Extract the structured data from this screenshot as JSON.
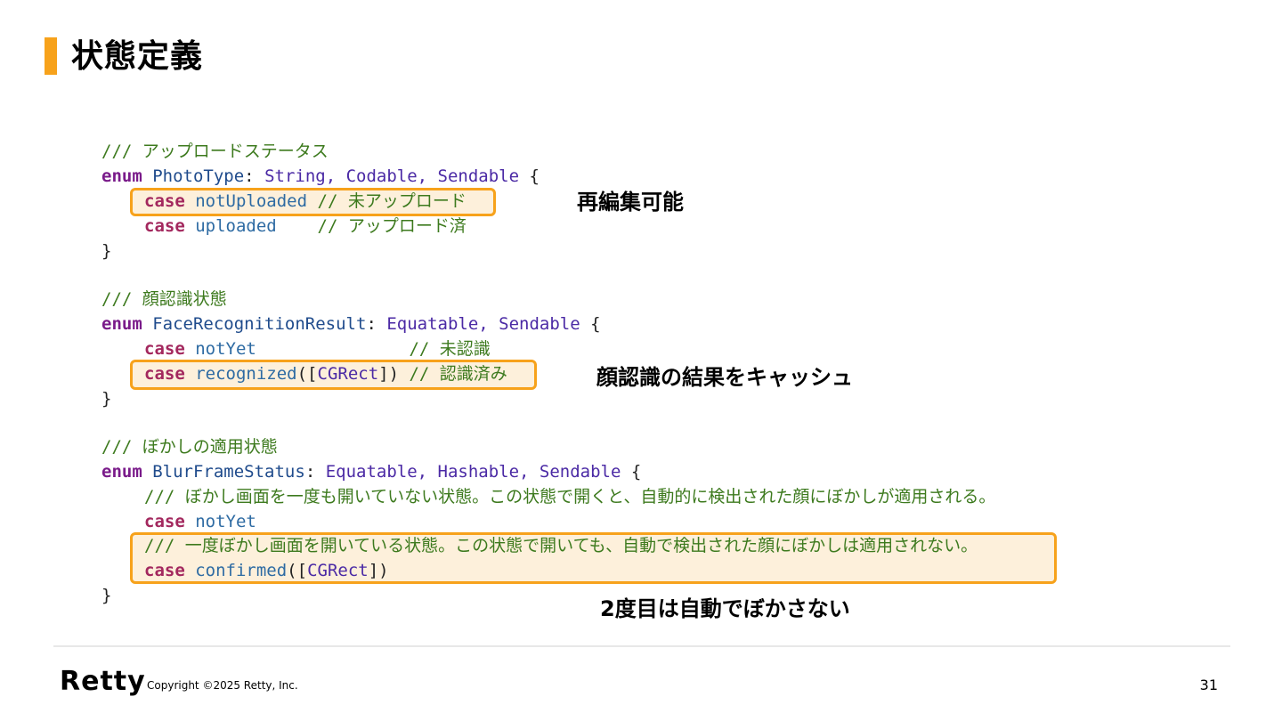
{
  "slide": {
    "title": "状態定義",
    "page_number": "31",
    "brand": "Retty",
    "copyright": "Copyright ©2025 Retty, Inc."
  },
  "code": {
    "block1": {
      "comment": "/// アップロードステータス",
      "enum_kw": "enum",
      "name": "PhotoType",
      "colon": ": ",
      "conformances": "String, Codable, Sendable",
      "open": " {",
      "case1_kw": "case",
      "case1_name": "notUploaded",
      "case1_comment": "// 未アップロード",
      "case2_kw": "case",
      "case2_name": "uploaded",
      "case2_comment": "// アップロード済",
      "close": "}"
    },
    "block2": {
      "comment": "/// 顔認識状態",
      "enum_kw": "enum",
      "name": "FaceRecognitionResult",
      "colon": ": ",
      "conformances": "Equatable, Sendable",
      "open": " {",
      "case1_kw": "case",
      "case1_name": "notYet",
      "case1_comment": "// 未認識",
      "case2_kw": "case",
      "case2_name": "recognized",
      "case2_paren_open": "([",
      "case2_type": "CGRect",
      "case2_paren_close": "])",
      "case2_comment": "// 認識済み",
      "close": "}"
    },
    "block3": {
      "comment": "/// ぼかしの適用状態",
      "enum_kw": "enum",
      "name": "BlurFrameStatus",
      "colon": ": ",
      "conformances": "Equatable, Hashable, Sendable",
      "open": " {",
      "doc1": "/// ぼかし画面を一度も開いていない状態。この状態で開くと、自動的に検出された顔にぼかしが適用される。",
      "case1_kw": "case",
      "case1_name": "notYet",
      "doc2": "/// 一度ぼかし画面を開いている状態。この状態で開いても、自動で検出された顔にぼかしは適用されない。",
      "case2_kw": "case",
      "case2_name": "confirmed",
      "case2_paren_open": "([",
      "case2_type": "CGRect",
      "case2_paren_close": "])",
      "close": "}"
    }
  },
  "annotations": {
    "note1": "再編集可能",
    "note2": "顔認識の結果をキャッシュ",
    "note3": "2度目は自動でぼかさない"
  },
  "colors": {
    "accent": "#F7A21B",
    "highlight_fill": "#FDF0DB",
    "keyword": "#A3285E",
    "comment": "#3D7A1E",
    "type": "#1F4B8C"
  }
}
